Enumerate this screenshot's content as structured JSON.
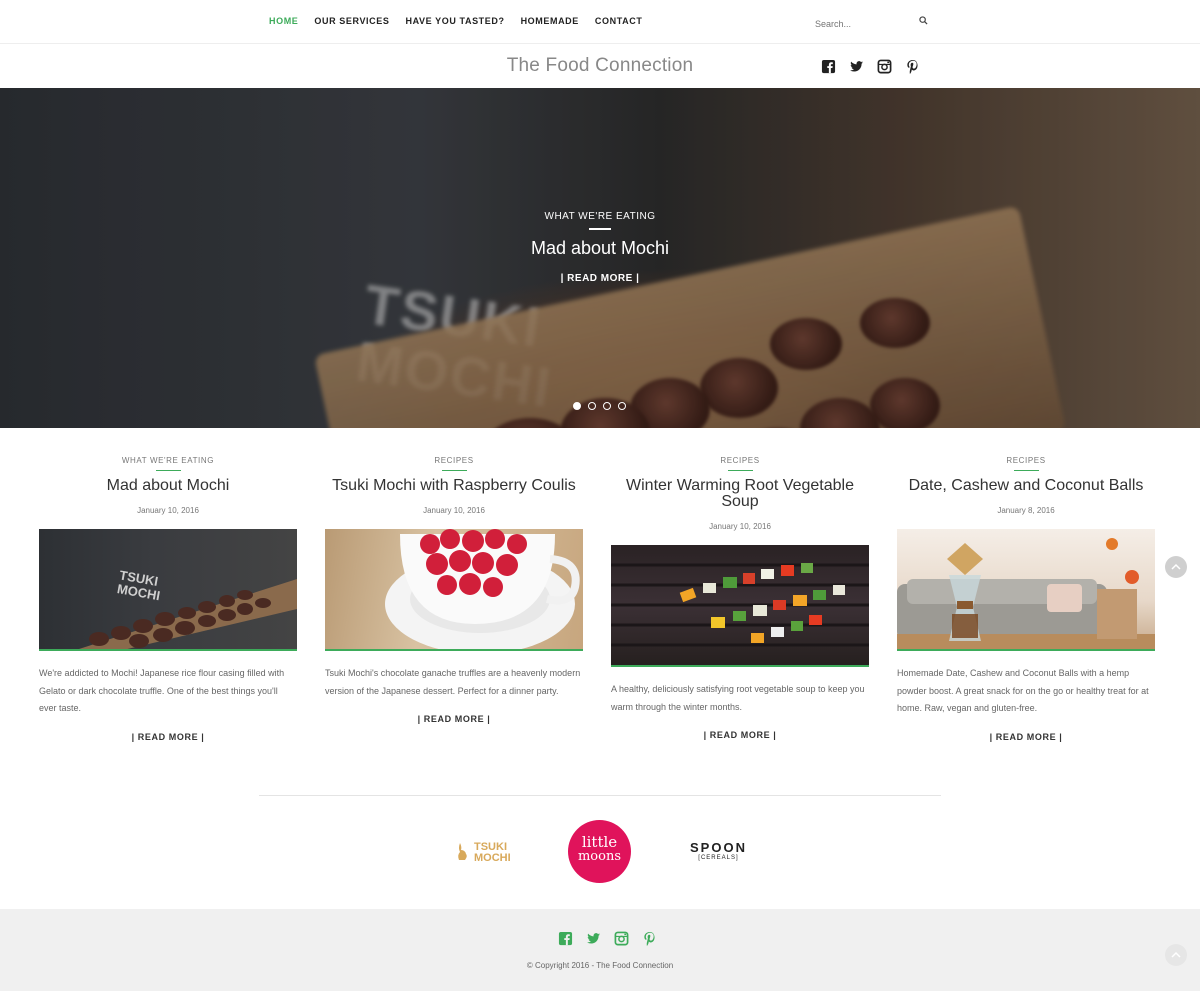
{
  "nav": {
    "items": [
      {
        "label": "HOME",
        "active": true
      },
      {
        "label": "OUR SERVICES",
        "active": false
      },
      {
        "label": "HAVE YOU TASTED?",
        "active": false
      },
      {
        "label": "HOMEMADE",
        "active": false
      },
      {
        "label": "CONTACT",
        "active": false
      }
    ],
    "search_placeholder": "Search..."
  },
  "header": {
    "site_title": "The Food Connection",
    "social": [
      "facebook-icon",
      "twitter-icon",
      "instagram-icon",
      "pinterest-icon"
    ]
  },
  "hero": {
    "category": "WHAT WE'RE EATING",
    "title": "Mad about Mochi",
    "read_more": "| READ MORE |",
    "slides": 4,
    "active_slide": 1,
    "logo_text": "TSUKI MOCHI"
  },
  "posts": [
    {
      "category": "WHAT WE'RE EATING",
      "title": "Mad about Mochi",
      "date": "January 10, 2016",
      "text": "We're addicted to Mochi! Japanese rice flour casing filled with Gelato or dark chocolate truffle. One of the best things you'll ever taste.",
      "read_more": "|  READ MORE  |"
    },
    {
      "category": "RECIPES",
      "title": "Tsuki Mochi with Raspberry Coulis",
      "date": "January 10, 2016",
      "text": "Tsuki Mochi's chocolate ganache truffles are a heavenly modern version of the Japanese dessert. Perfect for a dinner party.",
      "read_more": "|  READ MORE  |"
    },
    {
      "category": "RECIPES",
      "title": "Winter Warming Root Vegetable Soup",
      "date": "January 10, 2016",
      "text": "A healthy, deliciously satisfying root vegetable soup to keep you warm through the winter months.",
      "read_more": "|  READ MORE  |"
    },
    {
      "category": "RECIPES",
      "title": "Date, Cashew and Coconut Balls",
      "date": "January 8, 2016",
      "text": "Homemade Date, Cashew and Coconut Balls with a hemp powder boost. A great snack for on the go or healthy treat for at home. Raw, vegan and gluten-free.",
      "read_more": "|  READ MORE  |"
    }
  ],
  "partners": {
    "tsuki_line1": "TSUKI",
    "tsuki_line2": "MOCHI",
    "moons_line1": "little",
    "moons_line2": "moons",
    "spoon_line1": "SPOON",
    "spoon_line2": "[CEREALS]"
  },
  "footer": {
    "copyright": "© Copyright 2016 - The Food Connection",
    "social": [
      "facebook-icon",
      "twitter-icon",
      "instagram-icon",
      "pinterest-icon"
    ]
  },
  "colors": {
    "accent": "#3dab5a",
    "nav_text": "#222222",
    "footer_bg": "#f0f0f0",
    "little_moons": "#e0135b",
    "tsuki_gold": "#d8a95b"
  }
}
